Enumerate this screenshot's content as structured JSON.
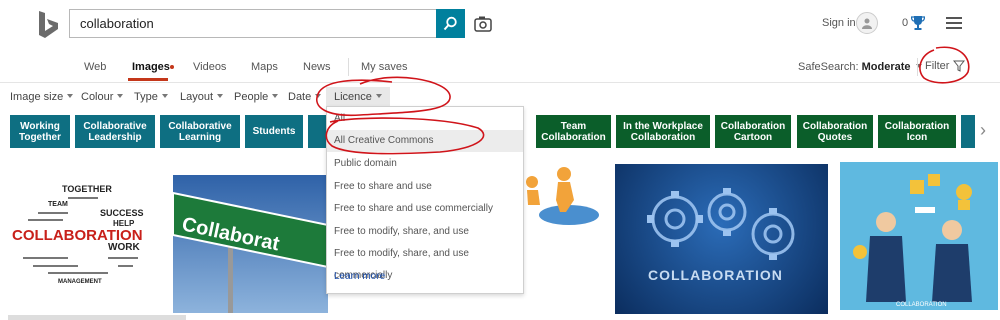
{
  "search": {
    "value": "collaboration"
  },
  "header": {
    "signin": "Sign in",
    "rewards": "0"
  },
  "nav": {
    "web": "Web",
    "images": "Images",
    "videos": "Videos",
    "maps": "Maps",
    "news": "News",
    "my_saves": "My saves"
  },
  "safesearch": {
    "label": "SafeSearch:",
    "value": "Moderate"
  },
  "filter_label": "Filter",
  "filters": {
    "image_size": "Image size",
    "colour": "Colour",
    "type": "Type",
    "layout": "Layout",
    "people": "People",
    "date": "Date",
    "licence": "Licence"
  },
  "tags": [
    {
      "label": "Working Together"
    },
    {
      "label": "Collaborative Leadership"
    },
    {
      "label": "Collaborative Learning"
    },
    {
      "label": "Students"
    },
    {
      "label": "Team Collaboration"
    },
    {
      "label": "In the Workplace Collaboration"
    },
    {
      "label": "Collaboration Cartoon"
    },
    {
      "label": "Collaboration Quotes"
    },
    {
      "label": "Collaboration Icon"
    }
  ],
  "licence_menu": {
    "all": "All",
    "all_cc": "All Creative Commons",
    "public_domain": "Public domain",
    "share_use": "Free to share and use",
    "share_use_commercial": "Free to share and use commercially",
    "modify_share_use": "Free to modify, share, and use",
    "modify_share_use_commercial": "Free to modify, share, and use commercially",
    "learn_more": "Learn more"
  },
  "images": {
    "wordcloud_title": "COLLABORATION",
    "roadsign_text": "Collaborat",
    "gears_text": "COLLABORATION",
    "business_caption": "COLLABORATION",
    "wordcloud_words": [
      "TOGETHER",
      "SUCCESS",
      "TEAM",
      "WORK",
      "MANAGEMENT",
      "HELP"
    ]
  },
  "colors": {
    "accent": "#00809d",
    "tag_blue": "#0e6f82",
    "tag_green": "#0b5e2a",
    "images_underline": "#c4371a",
    "annotation": "#d0141a"
  }
}
